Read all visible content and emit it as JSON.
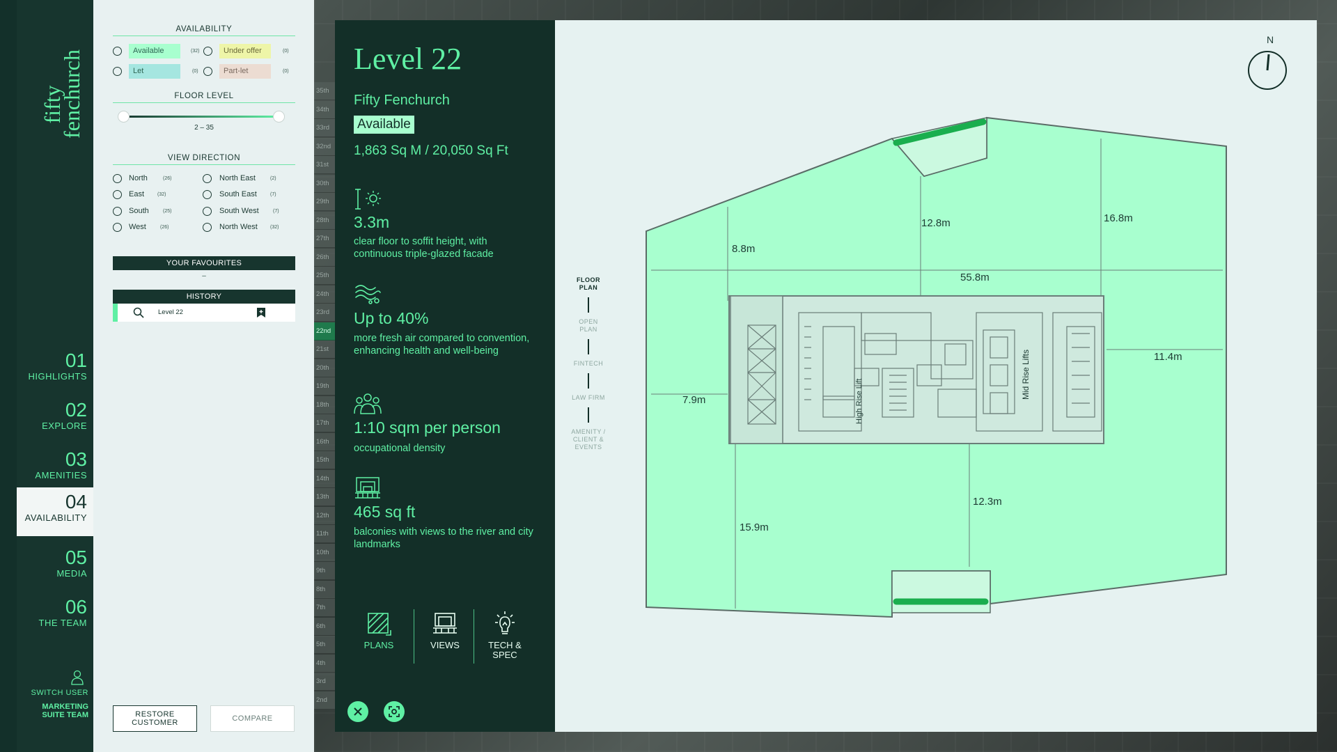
{
  "nav": {
    "logo_line1": "fifty",
    "logo_line2": "fenchurch",
    "items": [
      {
        "num": "01",
        "label": "HIGHLIGHTS"
      },
      {
        "num": "02",
        "label": "EXPLORE"
      },
      {
        "num": "03",
        "label": "AMENITIES"
      },
      {
        "num": "04",
        "label": "AVAILABILITY"
      },
      {
        "num": "05",
        "label": "MEDIA"
      },
      {
        "num": "06",
        "label": "THE TEAM"
      }
    ],
    "switch_user": "SWITCH USER",
    "team_name_line1": "MARKETING",
    "team_name_line2": "SUITE TEAM"
  },
  "filters": {
    "availability_title": "AVAILABILITY",
    "availability": [
      {
        "label": "Available",
        "count": "(32)",
        "color": "#a8ffcf"
      },
      {
        "label": "Under offer",
        "count": "(0)",
        "color": "#eef5a8"
      },
      {
        "label": "Let",
        "count": "(0)",
        "color": "#a5e6e0"
      },
      {
        "label": "Part-let",
        "count": "(0)",
        "color": "#ecdcd2"
      }
    ],
    "floor_level_title": "FLOOR LEVEL",
    "floor_range": "2 – 35",
    "floor_min_value": 2,
    "floor_max_value": 35,
    "view_direction_title": "VIEW DIRECTION",
    "directions": [
      {
        "label": "North",
        "count": "(26)"
      },
      {
        "label": "North East",
        "count": "(2)"
      },
      {
        "label": "East",
        "count": "(32)"
      },
      {
        "label": "South East",
        "count": "(7)"
      },
      {
        "label": "South",
        "count": "(25)"
      },
      {
        "label": "South West",
        "count": "(7)"
      },
      {
        "label": "West",
        "count": "(26)"
      },
      {
        "label": "North West",
        "count": "(32)"
      }
    ],
    "favourites_title": "YOUR FAVOURITES",
    "favourites_empty": "–",
    "history_title": "HISTORY",
    "history_item": "Level 22",
    "restore_line1": "RESTORE",
    "restore_line2": "CUSTOMER",
    "compare": "COMPARE"
  },
  "floors": [
    "35th",
    "34th",
    "33rd",
    "32nd",
    "31st",
    "30th",
    "29th",
    "28th",
    "27th",
    "26th",
    "25th",
    "24th",
    "23rd",
    "22nd",
    "21st",
    "20th",
    "19th",
    "18th",
    "17th",
    "16th",
    "15th",
    "14th",
    "13th",
    "12th",
    "11th",
    "10th",
    "9th",
    "8th",
    "7th",
    "6th",
    "5th",
    "4th",
    "3rd",
    "2nd"
  ],
  "selected_floor": "22nd",
  "info": {
    "title": "Level 22",
    "building": "Fifty Fenchurch",
    "status": "Available",
    "area": "1,863 Sq M / 20,050 Sq Ft",
    "features": [
      {
        "icon": "ceiling-height-sun-icon",
        "value": "3.3m",
        "desc": "clear floor to soffit height, with continuous triple-glazed facade"
      },
      {
        "icon": "fresh-air-icon",
        "value": "Up to 40%",
        "desc": "more fresh air compared to convention, enhancing health and well-being"
      },
      {
        "icon": "people-group-icon",
        "value": "1:10 sqm per person",
        "desc": "occupational density"
      },
      {
        "icon": "balcony-icon",
        "value": "465 sq ft",
        "desc": "balconies with views to the river and city landmarks"
      }
    ],
    "tabs": [
      {
        "label": "PLANS",
        "icon": "plans-icon"
      },
      {
        "label": "VIEWS",
        "icon": "views-icon"
      },
      {
        "label_line1": "TECH &",
        "label_line2": "SPEC",
        "icon": "tech-spec-icon"
      }
    ]
  },
  "plan": {
    "compass_label": "N",
    "steps": [
      "FLOOR PLAN",
      "OPEN PLAN",
      "FINTECH",
      "LAW FIRM",
      "AMENITY / CLIENT & EVENTS"
    ],
    "dimensions": [
      "12.8m",
      "16.8m",
      "8.8m",
      "55.8m",
      "11.4m",
      "7.9m",
      "12.3m",
      "15.9m"
    ],
    "core_labels": [
      "High Rise Lift",
      "Mid Rise Lifts"
    ],
    "floor_color": "#a8ffcf",
    "balcony_color": "#1aae4e"
  }
}
